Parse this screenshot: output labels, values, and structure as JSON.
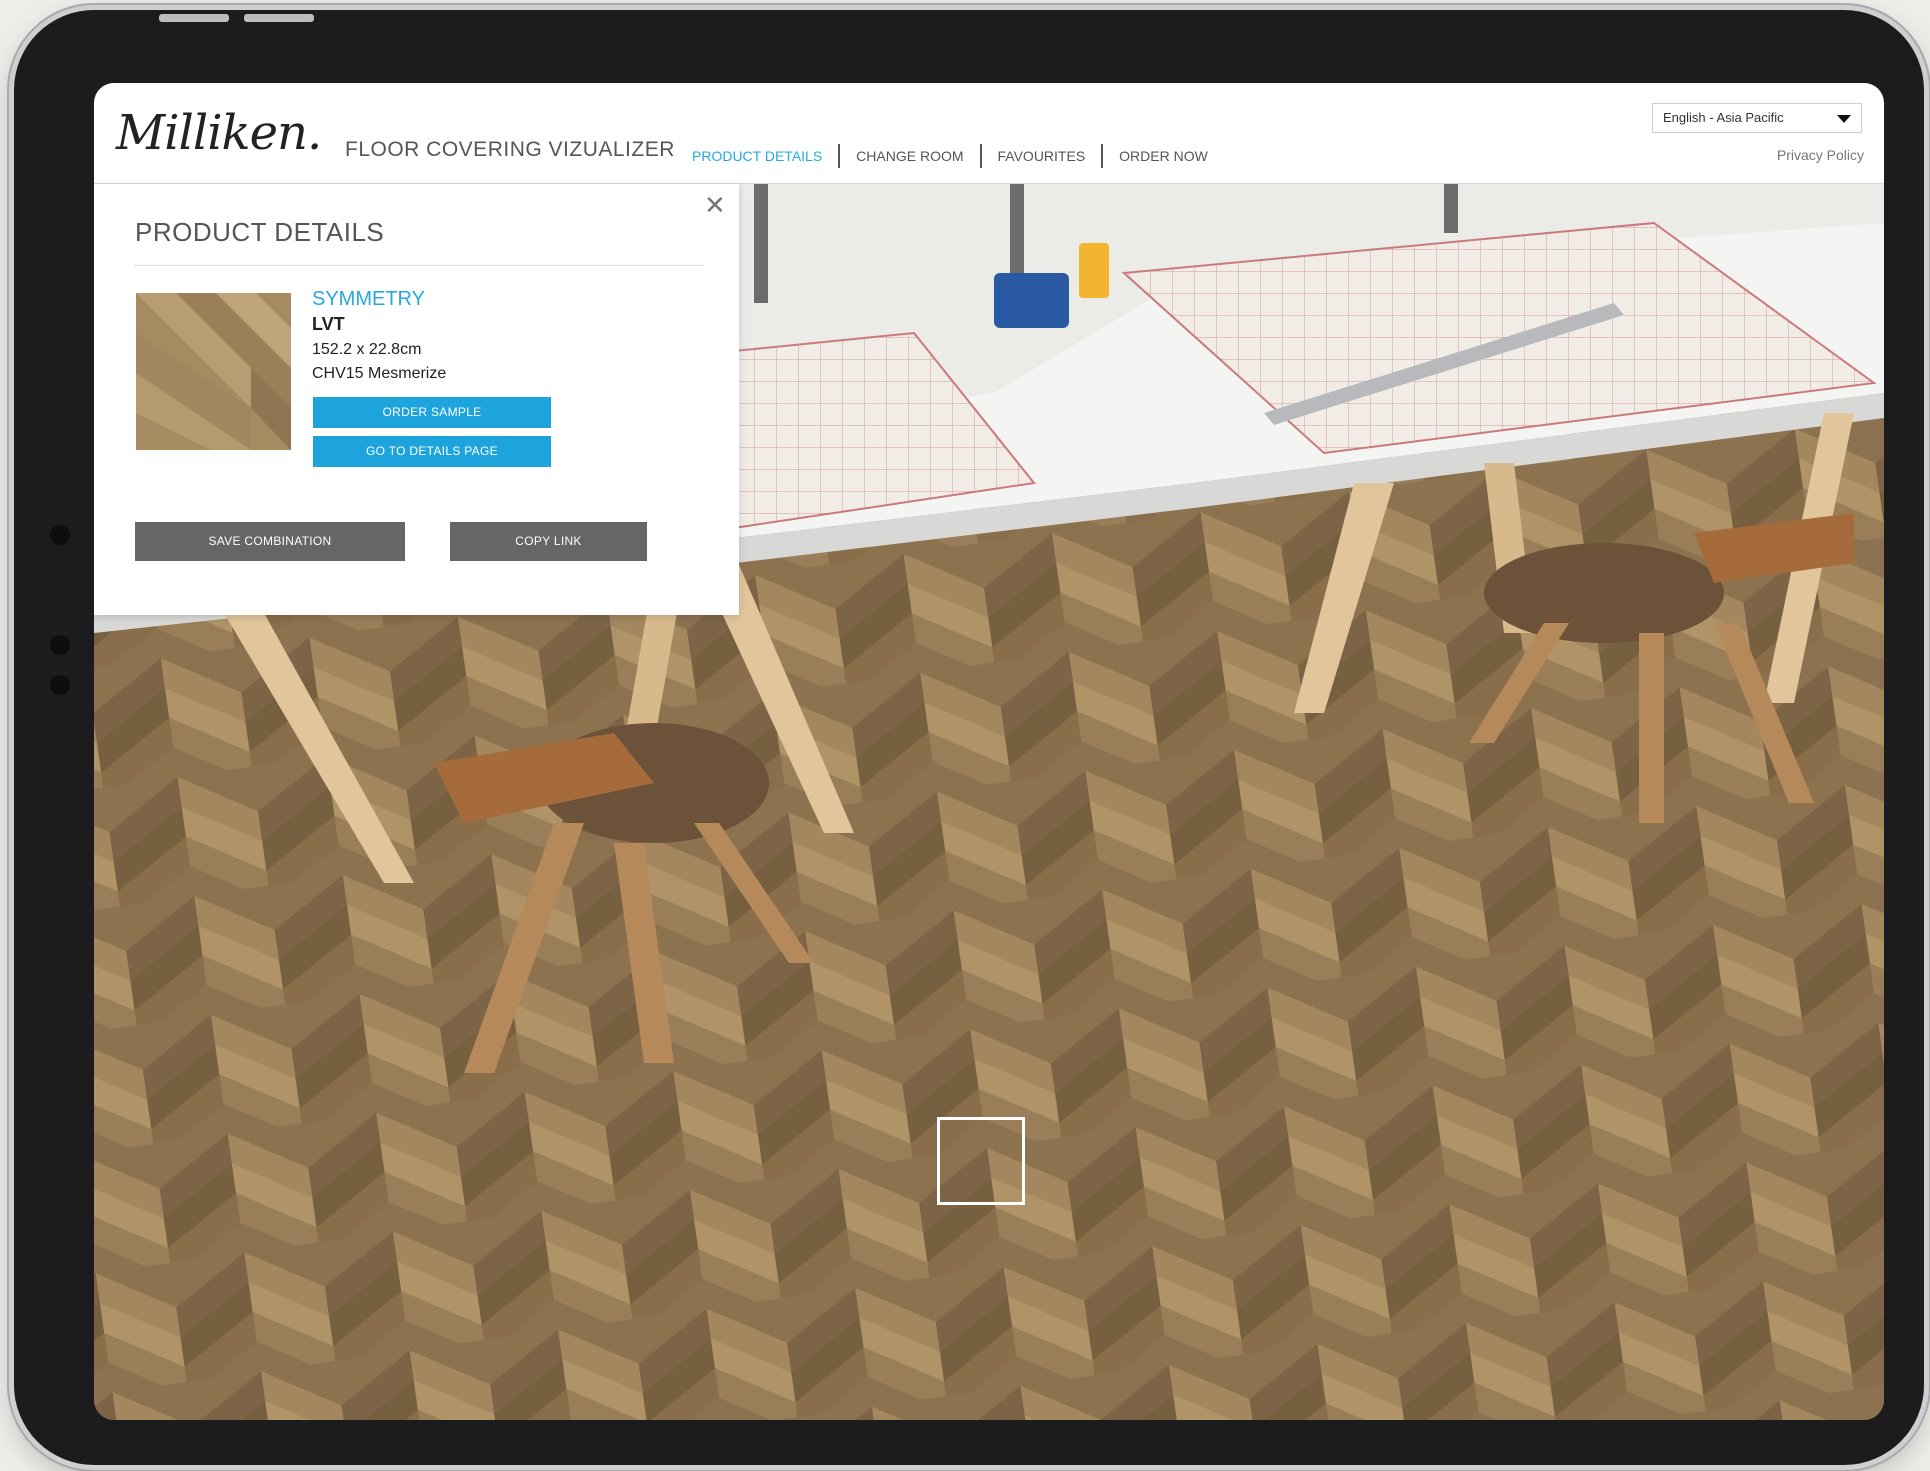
{
  "header": {
    "logo": "Milliken.",
    "app_title": "FLOOR COVERING VIZUALIZER",
    "nav": [
      {
        "label": "PRODUCT DETAILS",
        "active": true
      },
      {
        "label": "CHANGE ROOM",
        "active": false
      },
      {
        "label": "FAVOURITES",
        "active": false
      },
      {
        "label": "ORDER NOW",
        "active": false
      }
    ],
    "language": "English - Asia Pacific",
    "privacy_link": "Privacy Policy"
  },
  "panel": {
    "title": "PRODUCT DETAILS",
    "product": {
      "name": "SYMMETRY",
      "type": "LVT",
      "size": "152.2 x 22.8cm",
      "code": "CHV15 Mesmerize"
    },
    "order_sample": "ORDER SAMPLE",
    "details_page": "GO TO DETAILS PAGE",
    "save_combination": "SAVE COMBINATION",
    "copy_link": "COPY LINK",
    "close_icon": "close-icon"
  },
  "colors": {
    "accent": "#27a9e0",
    "button_blue": "#1ea4dc",
    "button_grey": "#666666",
    "floor": "#8a6f4e"
  }
}
